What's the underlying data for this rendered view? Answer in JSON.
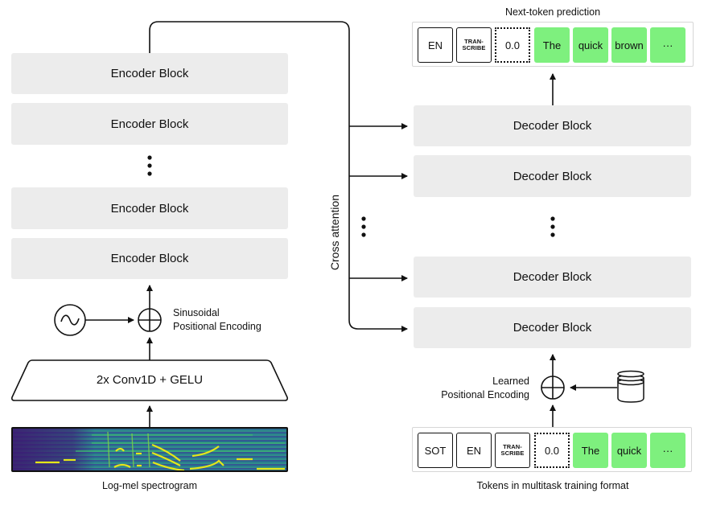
{
  "encoder": {
    "blocks": [
      {
        "label": "Encoder Block"
      },
      {
        "label": "Encoder Block"
      },
      {
        "label": "Encoder Block"
      },
      {
        "label": "Encoder Block"
      }
    ],
    "conv_label": "2x Conv1D + GELU",
    "positional_encoding_label_line1": "Sinusoidal",
    "positional_encoding_label_line2": "Positional Encoding",
    "input_caption": "Log-mel spectrogram",
    "sine_icon": "sine-wave-icon",
    "add_icon": "circle-plus-icon"
  },
  "cross_attention_label": "Cross attention",
  "decoder": {
    "blocks": [
      {
        "label": "Decoder Block"
      },
      {
        "label": "Decoder Block"
      },
      {
        "label": "Decoder Block"
      },
      {
        "label": "Decoder Block"
      }
    ],
    "positional_encoding_label_line1": "Learned",
    "positional_encoding_label_line2": "Positional Encoding",
    "embedding_icon": "database-icon",
    "add_icon": "circle-plus-icon"
  },
  "output_tokens": {
    "caption": "Next-token prediction",
    "tokens": [
      {
        "text": "EN",
        "style": "special"
      },
      {
        "text": "TRAN-\nSCRIBE",
        "style": "special-small"
      },
      {
        "text": "0.0",
        "style": "timestamp"
      },
      {
        "text": "The",
        "style": "text"
      },
      {
        "text": "quick",
        "style": "text"
      },
      {
        "text": "brown",
        "style": "text"
      },
      {
        "text": "···",
        "style": "text"
      }
    ]
  },
  "input_tokens": {
    "caption": "Tokens in multitask training format",
    "tokens": [
      {
        "text": "SOT",
        "style": "special"
      },
      {
        "text": "EN",
        "style": "special"
      },
      {
        "text": "TRAN-\nSCRIBE",
        "style": "special-small"
      },
      {
        "text": "0.0",
        "style": "timestamp"
      },
      {
        "text": "The",
        "style": "text"
      },
      {
        "text": "quick",
        "style": "text"
      },
      {
        "text": "···",
        "style": "text"
      }
    ]
  },
  "colors": {
    "block_fill": "#ececec",
    "text_token_fill": "#7ef07e",
    "line": "#111111"
  }
}
